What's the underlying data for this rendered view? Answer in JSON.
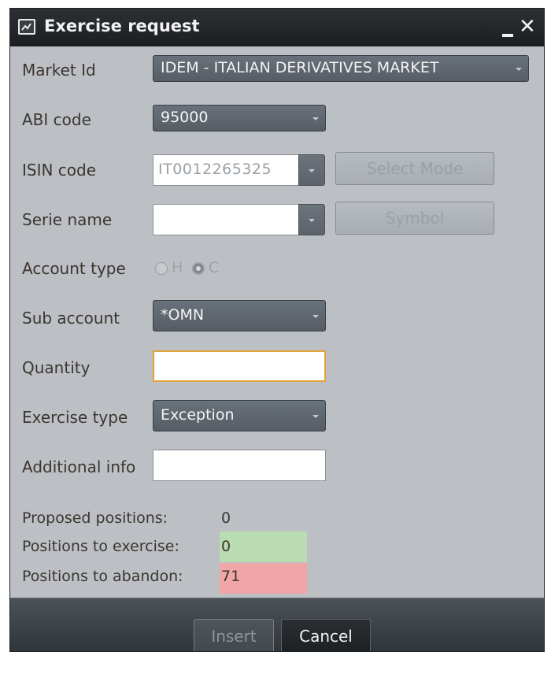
{
  "window": {
    "title": "Exercise request",
    "minimize_label": "_",
    "close_label": "✕"
  },
  "form": {
    "market_id": {
      "label": "Market Id",
      "value": "IDEM - ITALIAN DERIVATIVES MARKET"
    },
    "abi_code": {
      "label": "ABI code",
      "value": "95000"
    },
    "isin_code": {
      "label": "ISIN code",
      "value": "IT0012265325",
      "button": "Select Mode"
    },
    "serie_name": {
      "label": "Serie name",
      "value": "",
      "button": "Symbol"
    },
    "account_type": {
      "label": "Account type",
      "options": [
        "H",
        "C"
      ],
      "selected": "C"
    },
    "sub_account": {
      "label": "Sub account",
      "value": "*OMN"
    },
    "quantity": {
      "label": "Quantity",
      "value": ""
    },
    "exercise_type": {
      "label": "Exercise type",
      "value": "Exception"
    },
    "additional_info": {
      "label": "Additional info",
      "value": ""
    }
  },
  "positions": {
    "proposed": {
      "label": "Proposed positions:",
      "value": "0"
    },
    "to_exercise": {
      "label": "Positions to exercise:",
      "value": "0",
      "color": "#b9dcb3"
    },
    "to_abandon": {
      "label": "Positions to abandon:",
      "value": "71",
      "color": "#f0a6a6"
    }
  },
  "footer": {
    "insert_label": "Insert",
    "cancel_label": "Cancel"
  }
}
